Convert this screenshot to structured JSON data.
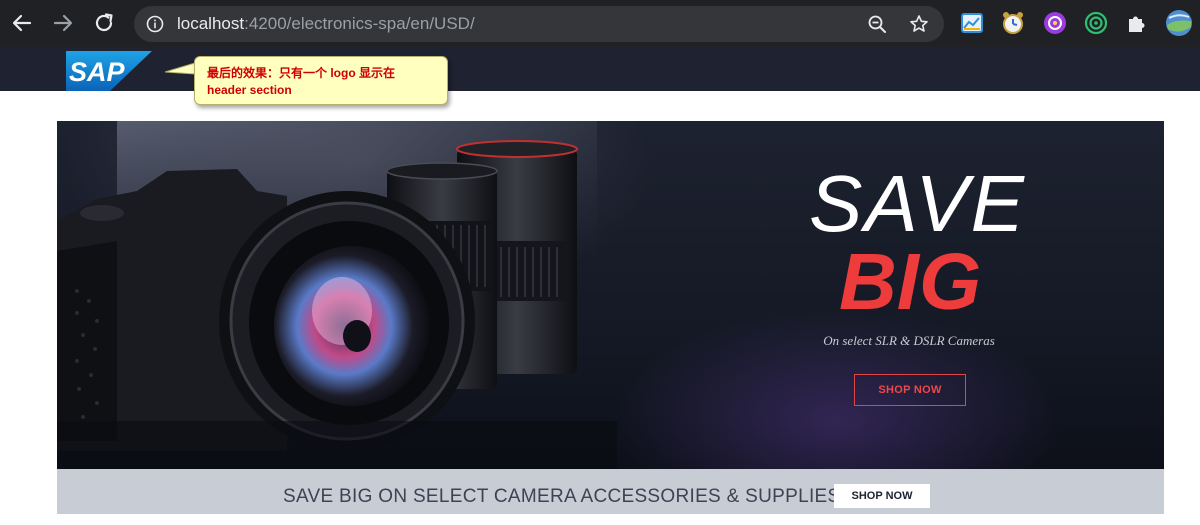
{
  "browser": {
    "url_host": "localhost",
    "url_path": ":4200/electronics-spa/en/USD/",
    "extensions": [
      "chart-extension-icon",
      "clock-extension-icon",
      "purple-extension-icon",
      "target-extension-icon",
      "puzzle-icon",
      "profile-avatar"
    ]
  },
  "header": {
    "logo_text": "SAP",
    "annotation_line1": "最后的效果：只有一个 logo 显示在",
    "annotation_line2": "header section"
  },
  "hero": {
    "headline_1": "SAVE",
    "headline_2": "BIG",
    "tagline": "On select SLR & DSLR Cameras",
    "cta": "SHOP NOW"
  },
  "promo": {
    "text": "SAVE BIG ON SELECT CAMERA ACCESSORIES & SUPPLIES",
    "cta": "SHOP NOW"
  },
  "colors": {
    "chrome_bg": "#202124",
    "header_bg": "#1e2231",
    "accent_red": "#ee3b3b",
    "promo_bg": "#c8ccd5",
    "annotation_bg": "#ffffbf",
    "annotation_text": "#d00000"
  }
}
